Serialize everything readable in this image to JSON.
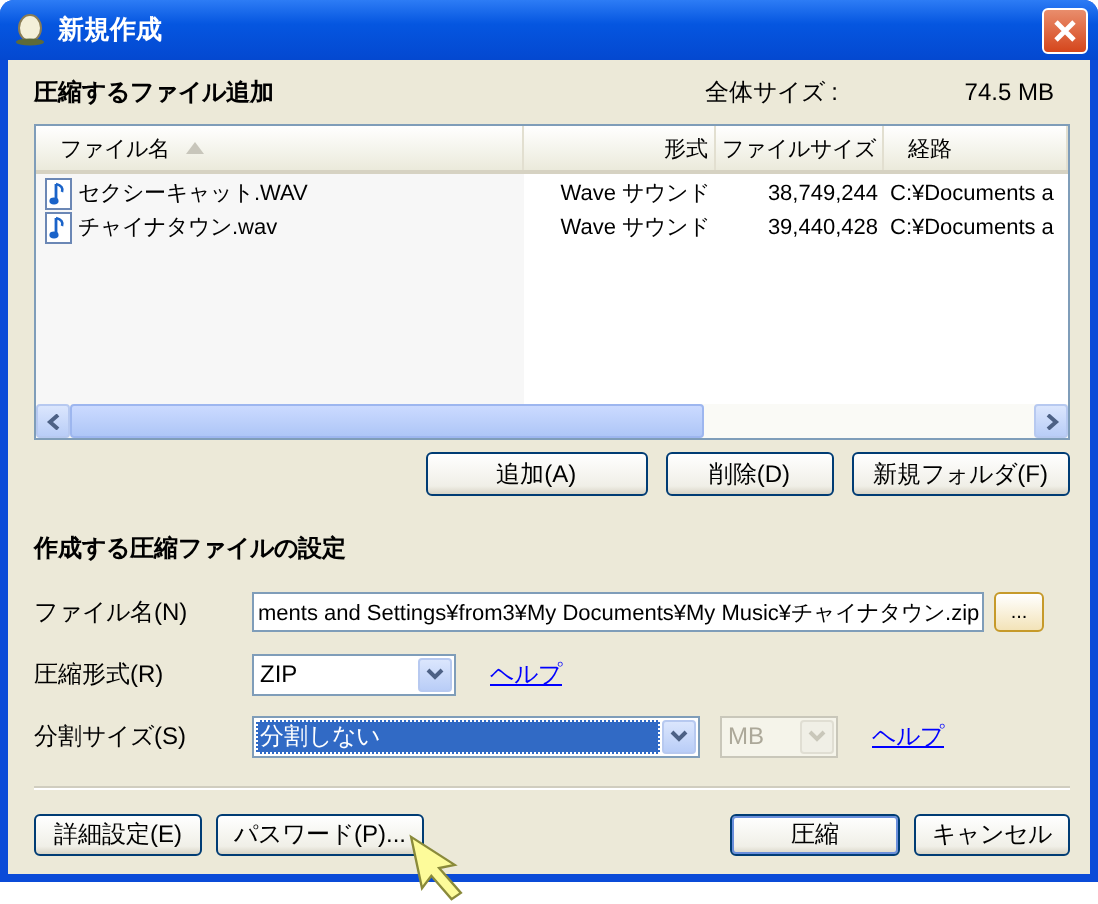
{
  "window": {
    "title": "新規作成"
  },
  "files_section": {
    "title": "圧縮するファイル追加",
    "total_label": "全体サイズ :",
    "total_value": "74.5 MB",
    "columns": [
      {
        "label": "ファイル名",
        "sorted": true
      },
      {
        "label": "形式",
        "sorted": false
      },
      {
        "label": "ファイルサイズ",
        "sorted": false
      },
      {
        "label": "経路",
        "sorted": false
      }
    ],
    "rows": [
      {
        "cells": [
          "セクシーキャット.WAV",
          "Wave サウンド",
          "38,749,244",
          "C:¥Documents a"
        ]
      },
      {
        "cells": [
          "チャイナタウン.wav",
          "Wave サウンド",
          "39,440,428",
          "C:¥Documents a"
        ]
      }
    ],
    "buttons": [
      "追加(A)",
      "削除(D)",
      "新規フォルダ(F)"
    ]
  },
  "settings": {
    "title": "作成する圧縮ファイルの設定",
    "fields": [
      {
        "kind": "text",
        "label": "ファイル名(N)",
        "value": "ments and Settings¥from3¥My Documents¥My Music¥チャイナタウン.zip",
        "button": "..."
      },
      {
        "kind": "select",
        "label": "圧縮形式(R)",
        "value": "ZIP",
        "selected": false,
        "help": "ヘルプ"
      },
      {
        "kind": "split",
        "label": "分割サイズ(S)",
        "value": "分割しない",
        "selected": true,
        "unit": "MB",
        "unit_disabled": true,
        "help": "ヘルプ"
      }
    ]
  },
  "footer": {
    "left_buttons": [
      {
        "label": "詳細設定(E)",
        "default": false
      },
      {
        "label": "パスワード(P)...",
        "default": false
      }
    ],
    "right_buttons": [
      {
        "label": "圧縮",
        "default": true
      },
      {
        "label": "キャンセル",
        "default": false
      }
    ]
  }
}
